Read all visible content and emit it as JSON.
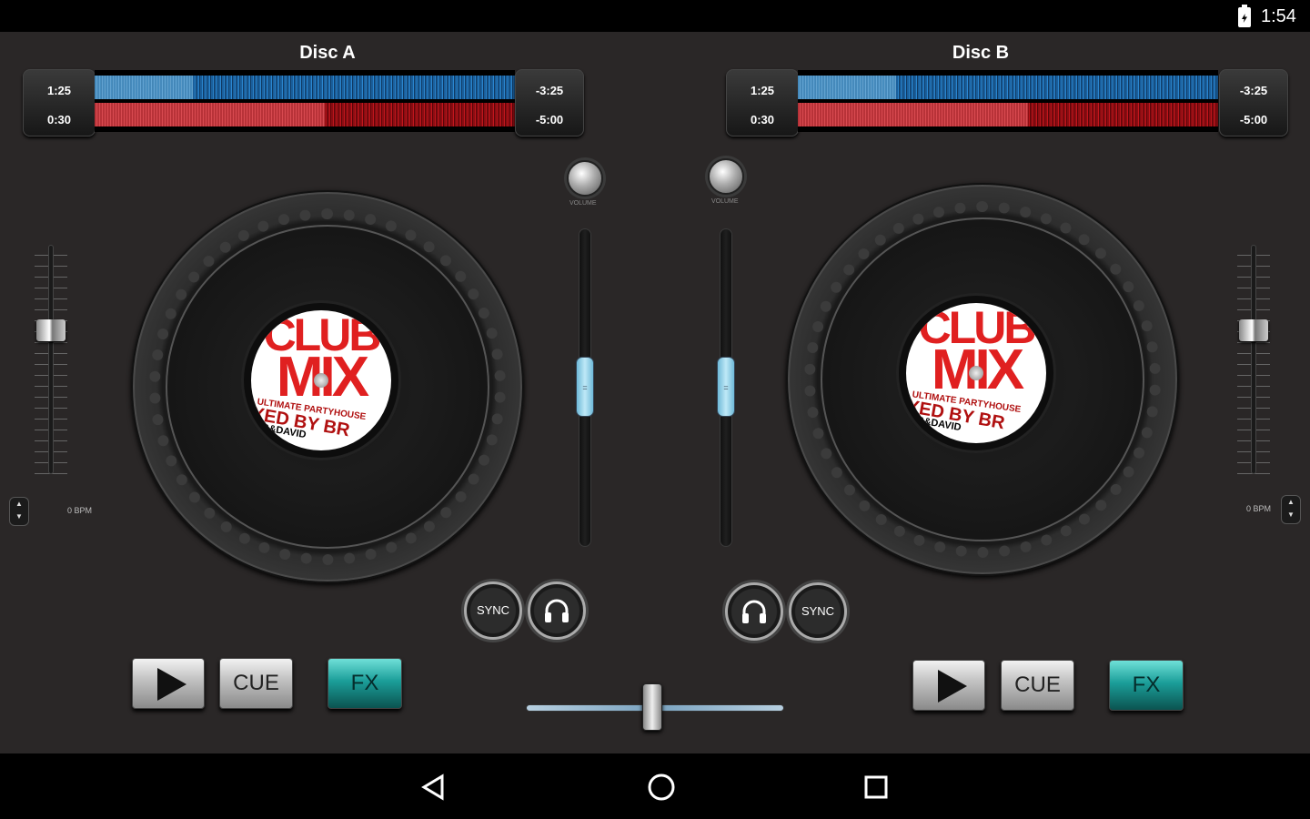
{
  "status_bar": {
    "time": "1:54",
    "battery_icon": "battery-charging-icon"
  },
  "deck_a": {
    "title": "Disc A",
    "elapsed_top": "1:25",
    "elapsed_bottom": "0:30",
    "remaining_top": "-3:25",
    "remaining_bottom": "-5:00",
    "bpm": "0 BPM",
    "volume_label": "VOLUME",
    "volume_level": 0.5,
    "pitch_level": 0.5,
    "label": {
      "line1": "CLUB",
      "line2": "MIX",
      "line3": "ULTIMATE PARTYHOUSE",
      "line4": "XED BY BR",
      "line5": "G&DAVID"
    },
    "sync_label": "SYNC",
    "cue_label": "CUE",
    "fx_label": "FX"
  },
  "deck_b": {
    "title": "Disc B",
    "elapsed_top": "1:25",
    "elapsed_bottom": "0:30",
    "remaining_top": "-3:25",
    "remaining_bottom": "-5:00",
    "bpm": "0 BPM",
    "volume_label": "VOLUME",
    "volume_level": 0.5,
    "pitch_level": 0.5,
    "label": {
      "line1": "CLUB",
      "line2": "MIX",
      "line3": "ULTIMATE PARTYHOUSE",
      "line4": "XED BY BR",
      "line5": "G&DAVID"
    },
    "sync_label": "SYNC",
    "cue_label": "CUE",
    "fx_label": "FX"
  },
  "crossfader_level": 0.5,
  "colors": {
    "background": "#2a2727",
    "waveform_blue": "#2b86cf",
    "waveform_red": "#c2161d",
    "fx_accent": "#1b9e99",
    "volume_slider": "#bfe9f7",
    "label_red": "#e02020"
  },
  "nav": {
    "back_icon": "back-triangle-icon",
    "home_icon": "home-circle-icon",
    "recents_icon": "recents-square-icon"
  }
}
